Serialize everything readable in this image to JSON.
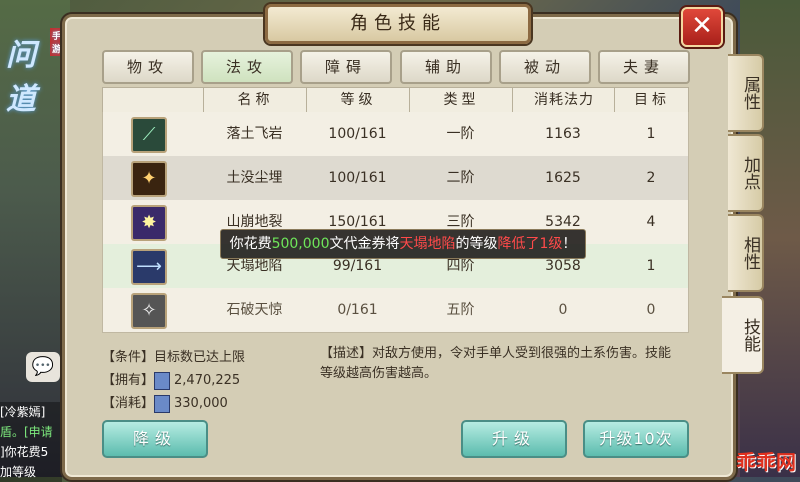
{
  "window": {
    "title": "角色技能",
    "close_symbol": "✕"
  },
  "logo": {
    "text": "问道",
    "tag": "手游"
  },
  "tabs": [
    {
      "label": "物攻",
      "active": false
    },
    {
      "label": "法攻",
      "active": true
    },
    {
      "label": "障碍",
      "active": false
    },
    {
      "label": "辅助",
      "active": false
    },
    {
      "label": "被动",
      "active": false
    },
    {
      "label": "夫妻",
      "active": false
    }
  ],
  "table": {
    "headers": [
      "",
      "名称",
      "等级",
      "类型",
      "消耗法力",
      "目标"
    ],
    "rows": [
      {
        "icon": "blade-skill-icon",
        "name": "落土飞岩",
        "level": "100/161",
        "type": "一阶",
        "mana": "1163",
        "target": "1"
      },
      {
        "icon": "sword-skill-icon",
        "name": "土没尘埋",
        "level": "100/161",
        "type": "二阶",
        "mana": "1625",
        "target": "2"
      },
      {
        "icon": "burst-skill-icon",
        "name": "山崩地裂",
        "level": "150/161",
        "type": "三阶",
        "mana": "5342",
        "target": "4"
      },
      {
        "icon": "spear-skill-icon",
        "name": "天塌地陷",
        "level": "99/161",
        "type": "四阶",
        "mana": "3058",
        "target": "1"
      },
      {
        "icon": "shatter-skill-icon",
        "name": "石破天惊",
        "level": "0/161",
        "type": "五阶",
        "mana": "0",
        "target": "0"
      }
    ]
  },
  "toast": {
    "p1": "你花费",
    "amount": "500,000",
    "p2": "文代金券将",
    "skill": "天塌地陷",
    "p3": "的等级",
    "result": "降低了1级",
    "p4": "！"
  },
  "info": {
    "condition_label": "【条件】",
    "condition_value": "目标数已达上限",
    "own_label": "【拥有】",
    "own_value": "2,470,225",
    "cost_label": "【消耗】",
    "cost_value": "330,000",
    "desc_label": "【描述】",
    "desc_text": "对敌方使用，令对手单人受到很强的土系伤害。技能等级越高伤害越高。"
  },
  "buttons": {
    "downgrade": "降级",
    "upgrade": "升级",
    "upgrade10": "升级10次"
  },
  "side_tabs": [
    "属性",
    "加点",
    "相性",
    "技能"
  ],
  "chat": {
    "line1": "[冷紫嫣]",
    "line2": "盾。[申请",
    "line3": "]你花费5",
    "line4": "加等级"
  },
  "watermark": "乖乖网"
}
